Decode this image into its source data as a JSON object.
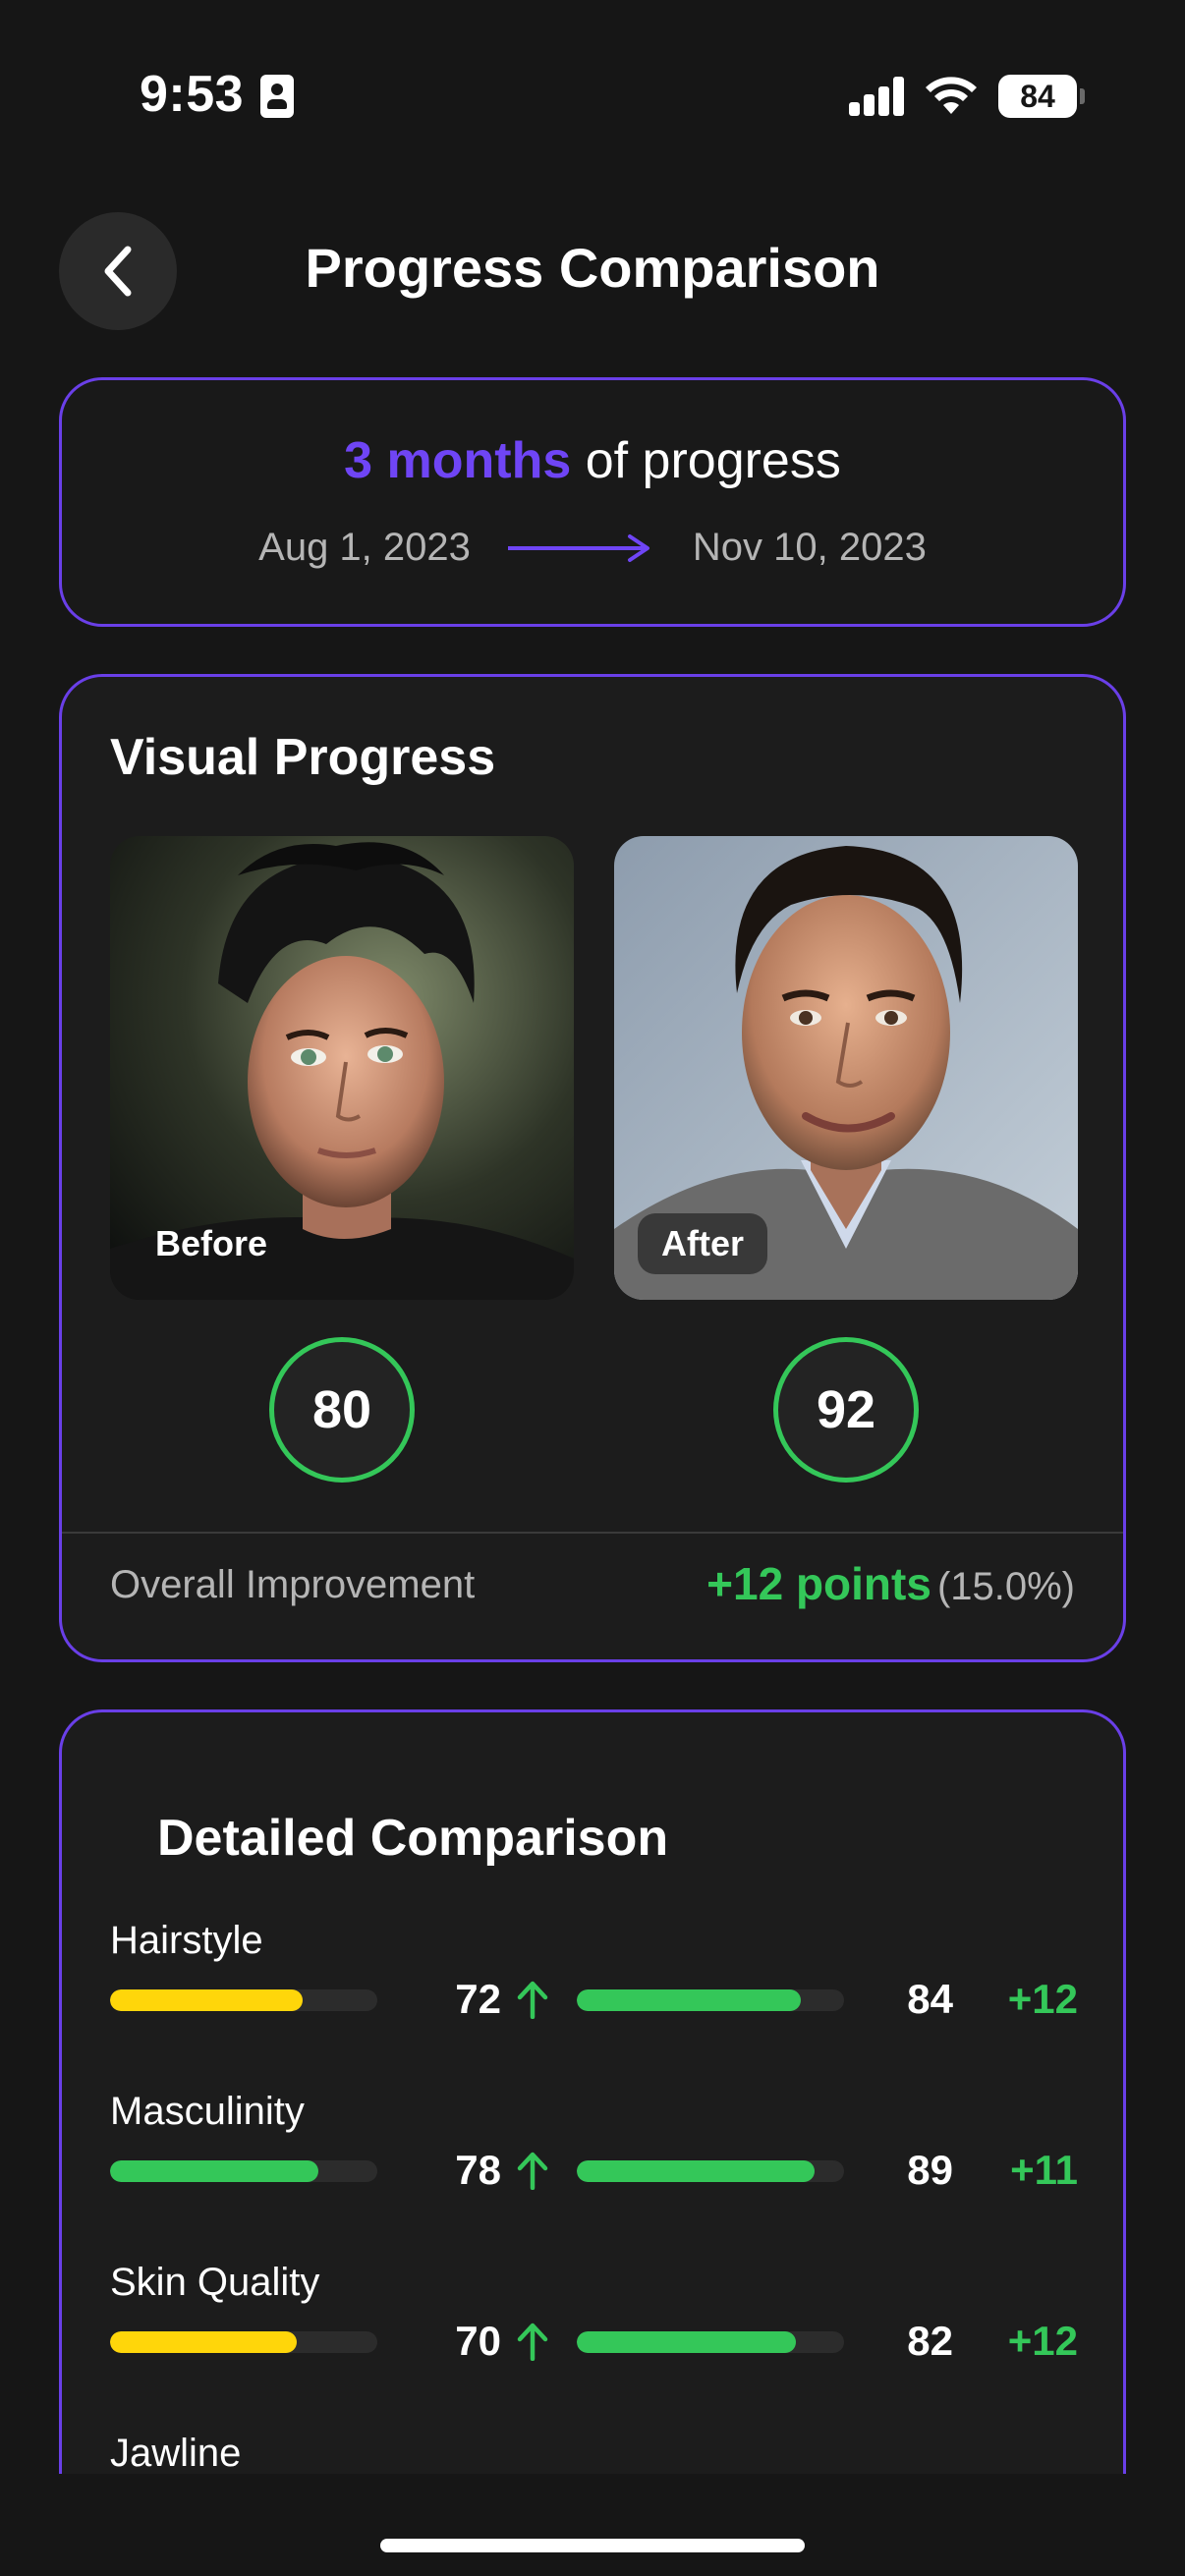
{
  "status_bar": {
    "time": "9:53",
    "battery": "84"
  },
  "header": {
    "title": "Progress Comparison"
  },
  "range": {
    "duration": "3 months",
    "suffix": " of progress",
    "start_date": "Aug 1, 2023",
    "end_date": "Nov 10, 2023"
  },
  "visual": {
    "title": "Visual Progress",
    "before_label": "Before",
    "after_label": "After",
    "before_score": "80",
    "after_score": "92",
    "improvement_label": "Overall Improvement",
    "improvement_points": "+12 points",
    "improvement_percent": "(15.0%)"
  },
  "detailed": {
    "title": "Detailed Comparison",
    "metrics": [
      {
        "name": "Hairstyle",
        "before": "72",
        "after": "84",
        "delta": "+12",
        "before_color": "#FFD60A",
        "after_color": "#34C759"
      },
      {
        "name": "Masculinity",
        "before": "78",
        "after": "89",
        "delta": "+11",
        "before_color": "#34C759",
        "after_color": "#34C759"
      },
      {
        "name": "Skin Quality",
        "before": "70",
        "after": "82",
        "delta": "+12",
        "before_color": "#FFD60A",
        "after_color": "#34C759"
      },
      {
        "name": "Jawline"
      }
    ]
  },
  "colors": {
    "accent": "#6F45F5",
    "positive": "#34C759",
    "warning": "#FFD60A"
  }
}
